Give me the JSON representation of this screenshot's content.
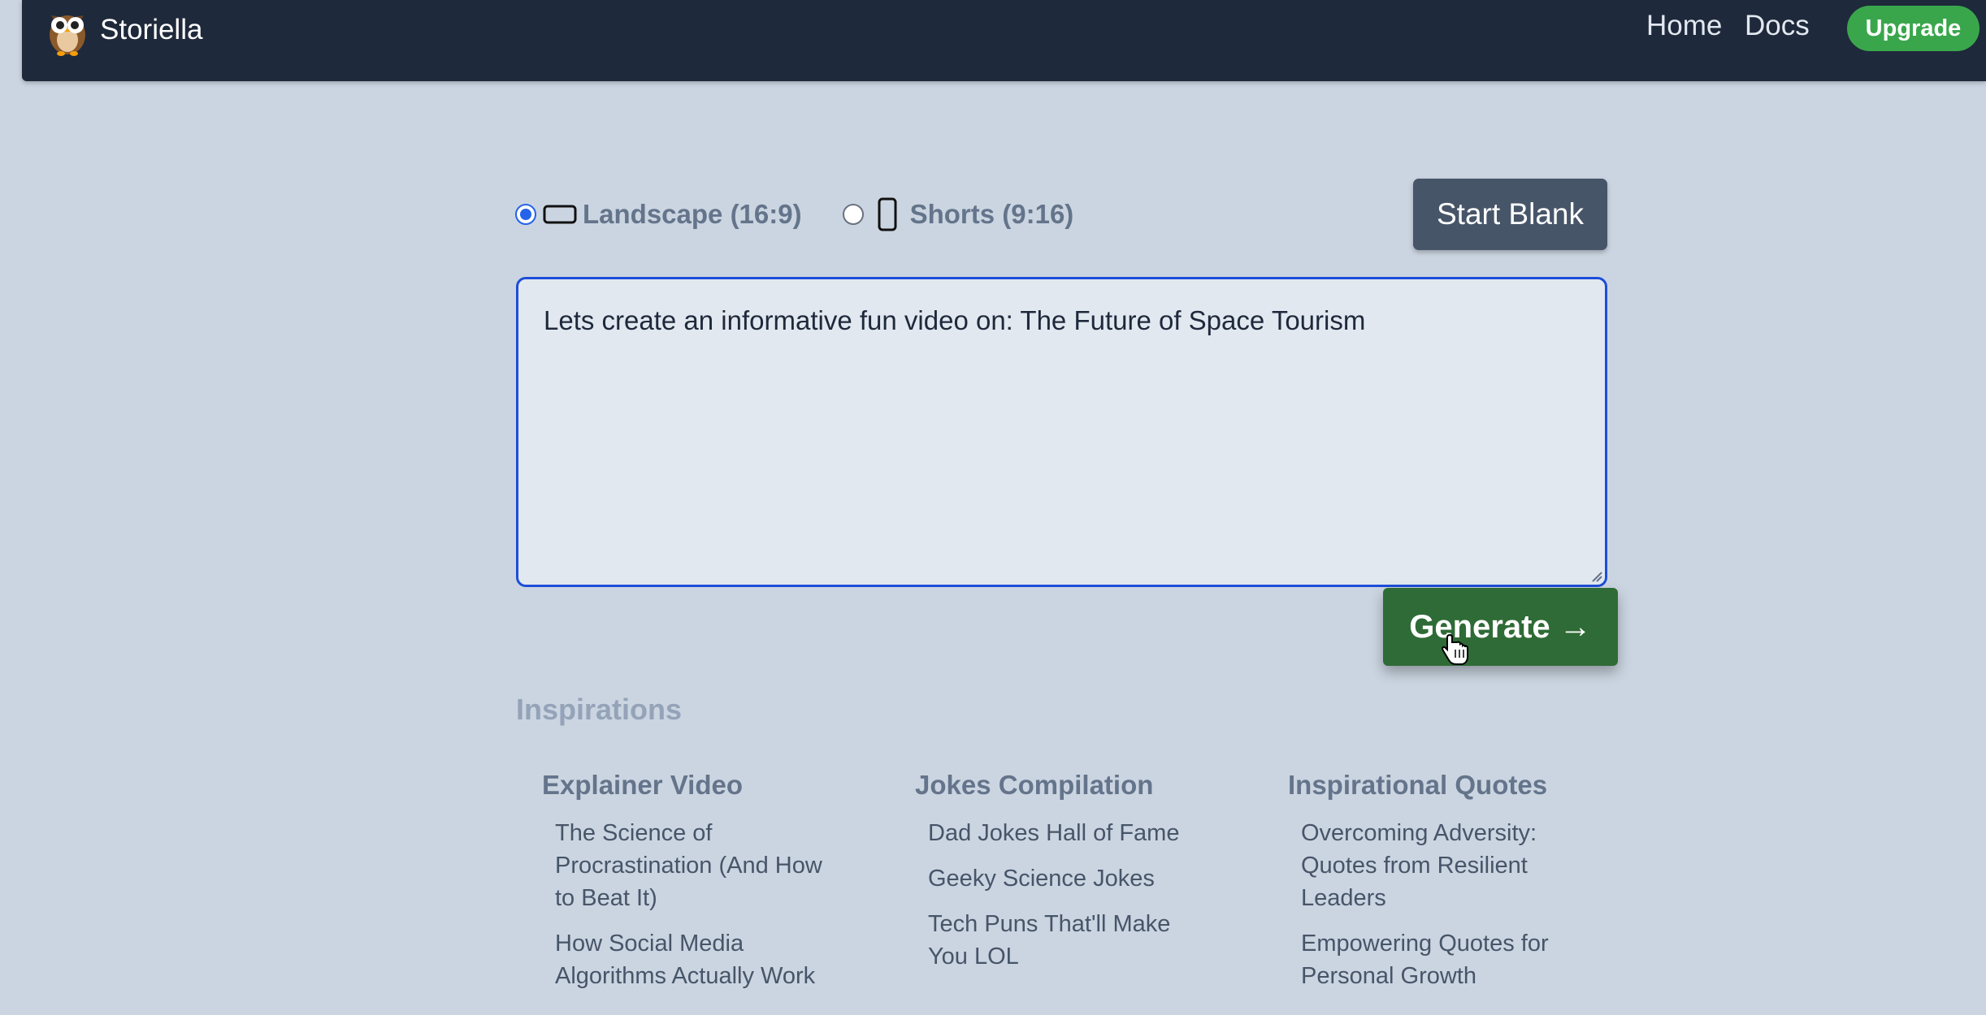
{
  "nav": {
    "brand": "Storiella",
    "links": [
      "Home",
      "Docs"
    ],
    "upgrade": "Upgrade"
  },
  "format": {
    "options": [
      {
        "label": "Landscape (16:9)",
        "checked": true,
        "icon": "landscape-screen-icon"
      },
      {
        "label": "Shorts (9:16)",
        "checked": false,
        "icon": "portrait-phone-icon"
      }
    ]
  },
  "start_blank": "Start Blank",
  "prompt": {
    "value": "Lets create an informative fun video on: The Future of Space Tourism"
  },
  "generate": "Generate →",
  "inspirations": {
    "title": "Inspirations",
    "columns": [
      {
        "title": "Explainer Video",
        "items": [
          "The Science of Procrastination (And How to Beat It)",
          "How Social Media Algorithms Actually Work"
        ]
      },
      {
        "title": "Jokes Compilation",
        "items": [
          "Dad Jokes Hall of Fame",
          "Geeky Science Jokes",
          "Tech Puns That'll Make You LOL"
        ]
      },
      {
        "title": "Inspirational Quotes",
        "items": [
          "Overcoming Adversity: Quotes from Resilient Leaders",
          "Empowering Quotes for Personal Growth"
        ]
      }
    ]
  },
  "colors": {
    "navbar": "#1e293b",
    "background": "#cbd5e1",
    "upgrade": "#3aa64c",
    "generate": "#2f6b36",
    "start_blank": "#475569",
    "focus_border": "#1d4ed8"
  }
}
